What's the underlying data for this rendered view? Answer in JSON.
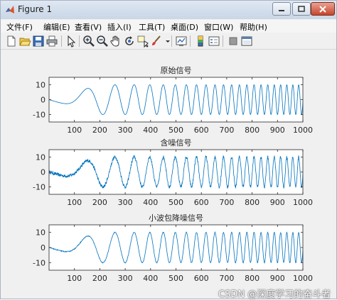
{
  "window": {
    "title": "Figure 1",
    "controls": [
      "minimize",
      "maximize",
      "close"
    ]
  },
  "menu": [
    {
      "label": "文件(F)"
    },
    {
      "label": "编辑(E)"
    },
    {
      "label": "查看(V)"
    },
    {
      "label": "插入(I)"
    },
    {
      "label": "工具(T)"
    },
    {
      "label": "桌面(D)"
    },
    {
      "label": "窗口(W)"
    },
    {
      "label": "帮助(H)"
    }
  ],
  "toolbar_icons": [
    "new-figure-icon",
    "open-file-icon",
    "save-icon",
    "print-icon",
    "edit-plot-icon",
    "zoom-in-icon",
    "zoom-out-icon",
    "pan-icon",
    "rotate-3d-icon",
    "data-cursor-icon",
    "brush-icon",
    "link-plot-icon",
    "insert-colorbar-icon",
    "insert-legend-icon",
    "hide-plot-tools-icon",
    "show-plot-tools-icon"
  ],
  "colors": {
    "line": "#0072bd",
    "axes_bg": "#ffffff",
    "figure_bg": "#f0f0f0"
  },
  "chart_data": [
    {
      "type": "line",
      "title": "原始信号",
      "xlim": [
        0,
        1000
      ],
      "ylim": [
        -15,
        15
      ],
      "xticks": [
        100,
        200,
        300,
        400,
        500,
        600,
        700,
        800,
        900,
        1000
      ],
      "yticks": [
        -10,
        0,
        10
      ],
      "series": [
        {
          "signal": "chirp",
          "amplitude_profile": [
            [
              0,
              0
            ],
            [
              200,
              10
            ],
            [
              270,
              10
            ],
            [
              350,
              10
            ],
            [
              1000,
              10
            ]
          ],
          "color": "#0072bd"
        }
      ]
    },
    {
      "type": "line",
      "title": "含噪信号",
      "xlim": [
        0,
        1000
      ],
      "ylim": [
        -15,
        15
      ],
      "xticks": [
        100,
        200,
        300,
        400,
        500,
        600,
        700,
        800,
        900,
        1000
      ],
      "yticks": [
        -10,
        0,
        10
      ],
      "series": [
        {
          "signal": "chirp + noise",
          "amplitude_profile": [
            [
              0,
              0
            ],
            [
              200,
              10
            ],
            [
              270,
              10
            ],
            [
              1000,
              10
            ]
          ],
          "noise": 1.0,
          "color": "#0072bd"
        }
      ]
    },
    {
      "type": "line",
      "title": "小波包降噪信号",
      "xlim": [
        0,
        1000
      ],
      "ylim": [
        -15,
        15
      ],
      "xticks": [
        100,
        200,
        300,
        400,
        500,
        600,
        700,
        800,
        900,
        1000
      ],
      "yticks": [
        -10,
        0,
        10
      ],
      "series": [
        {
          "signal": "denoised chirp",
          "amplitude_profile": [
            [
              0,
              0
            ],
            [
              200,
              10
            ],
            [
              270,
              10
            ],
            [
              1000,
              10
            ]
          ],
          "noise": 0.25,
          "color": "#0072bd"
        }
      ]
    }
  ],
  "watermark": "CSDN @深度学习的奋斗者"
}
